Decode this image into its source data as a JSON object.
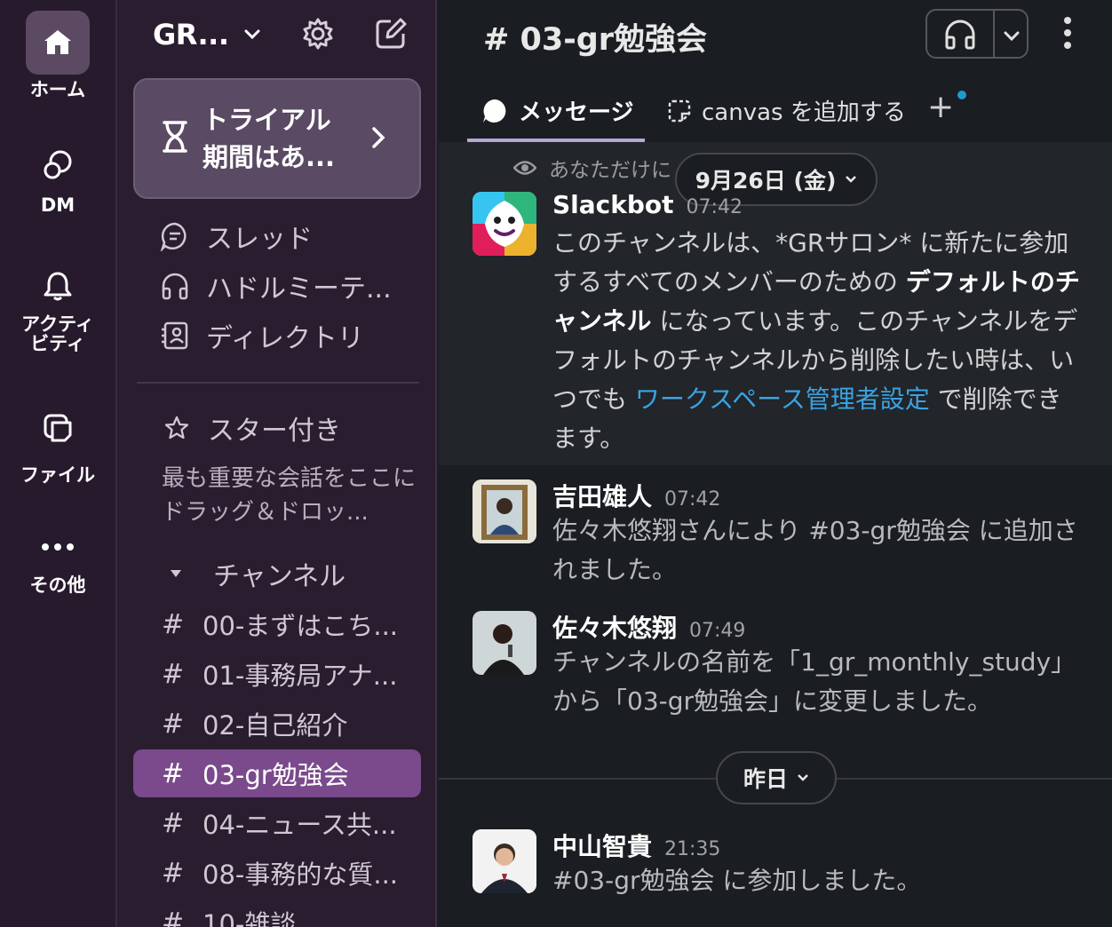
{
  "rail": {
    "home_label": "ホーム",
    "dm_label": "DM",
    "activity_label": "アクティ ビティ",
    "files_label": "ファイル",
    "more_label": "その他"
  },
  "sidebar": {
    "workspace_name": "GR...",
    "trial_line1": "トライアル",
    "trial_line2": "期間はあ...",
    "nav": [
      {
        "label": "スレッド",
        "icon": "threads-icon"
      },
      {
        "label": "ハドルミーテ...",
        "icon": "headphones-icon"
      },
      {
        "label": "ディレクトリ",
        "icon": "directory-icon"
      }
    ],
    "starred_label": "スター付き",
    "starred_hint": "最も重要な会話をここにドラッグ＆ドロッ...",
    "channels_label": "チャンネル",
    "channels": [
      {
        "name": "00-まずはこち..."
      },
      {
        "name": "01-事務局アナ..."
      },
      {
        "name": "02-自己紹介"
      },
      {
        "name": "03-gr勉強会"
      },
      {
        "name": "04-ニュース共..."
      },
      {
        "name": "08-事務的な質..."
      },
      {
        "name": "10-雑談"
      }
    ]
  },
  "main": {
    "channel_title": "# 03-gr勉強会",
    "tab_messages": "メッセージ",
    "tab_canvas": "canvas を追加する",
    "tab_add": "+",
    "system_notice": "あなただけに",
    "date_divider_1": "9月26日 (金)",
    "date_divider_2": "昨日",
    "messages": [
      {
        "name": "Slackbot",
        "time": "07:42",
        "text_a": "このチャンネルは、*GRサロン* に新たに参加するすべてのメンバーのための ",
        "text_bold": "デフォルトのチャンネル",
        "text_b": " になっています。このチャンネルをデフォルトのチャンネルから削除したい時は、いつでも ",
        "text_link": "ワークスペース管理者設定",
        "text_c": " で削除できます。"
      },
      {
        "name": "吉田雄人",
        "time": "07:42",
        "text": "佐々木悠翔さんにより #03-gr勉強会 に追加されました。"
      },
      {
        "name": "佐々木悠翔",
        "time": "07:49",
        "text": "チャンネルの名前を「1_gr_monthly_study」から「03-gr勉強会」に変更しました。"
      },
      {
        "name": "中山智貴",
        "time": "21:35",
        "text": "#03-gr勉強会 に参加しました。"
      }
    ]
  },
  "colors": {
    "rail_bg": "#271a2d",
    "sidebar_bg": "#2a1d30",
    "active_channel": "#7a4a8c",
    "main_bg": "#1a1d21",
    "link": "#3aa3e3"
  }
}
